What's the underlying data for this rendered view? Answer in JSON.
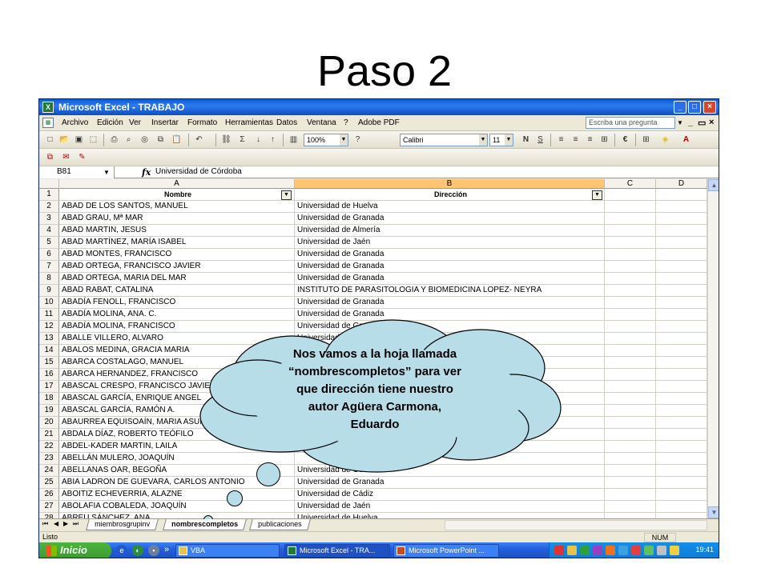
{
  "slide": {
    "title": "Paso 2"
  },
  "window": {
    "title": "Microsoft Excel - TRABAJO",
    "app_icon": "excel-icon",
    "min": "_",
    "max": "□",
    "close": "×"
  },
  "menu": {
    "items": [
      "Archivo",
      "Edición",
      "Ver",
      "Insertar",
      "Formato",
      "Herramientas",
      "Datos",
      "Ventana",
      "?",
      "Adobe PDF"
    ],
    "help_placeholder": "Escriba una pregunta",
    "doc_min": "_",
    "doc_restore": "▭",
    "doc_close": "×"
  },
  "toolbar": {
    "zoom": "100%",
    "font": "Calibri",
    "font_size": "11",
    "bold": "N",
    "underline": "S",
    "currency": "€"
  },
  "formula_bar": {
    "cell_ref": "B81",
    "fx": "fx",
    "content": "Universidad de Córdoba"
  },
  "sheet": {
    "columns": [
      "A",
      "B",
      "C",
      "D"
    ],
    "header_row": {
      "num": "1",
      "a": "Nombre",
      "b": "Dirección"
    },
    "rows": [
      {
        "num": "2",
        "a": "ABAD DE LOS SANTOS, MANUEL",
        "b": "Universidad de Huelva"
      },
      {
        "num": "3",
        "a": "ABAD GRAU, Mª MAR",
        "b": "Universidad de Granada"
      },
      {
        "num": "4",
        "a": "ABAD MARTIN, JESUS",
        "b": "Universidad de Almería"
      },
      {
        "num": "5",
        "a": "ABAD MARTÍNEZ, MARÍA ISABEL",
        "b": "Universidad de Jaén"
      },
      {
        "num": "6",
        "a": "ABAD MONTES, FRANCISCO",
        "b": "Universidad de Granada"
      },
      {
        "num": "7",
        "a": "ABAD ORTEGA, FRANCISCO JAVIER",
        "b": "Universidad de Granada"
      },
      {
        "num": "8",
        "a": "ABAD ORTEGA, MARIA DEL MAR",
        "b": "Universidad de Granada"
      },
      {
        "num": "9",
        "a": "ABAD RABAT, CATALINA",
        "b": "INSTITUTO DE PARASITOLOGIA Y BIOMEDICINA LOPEZ- NEYRA"
      },
      {
        "num": "10",
        "a": "ABADÍA FENOLL, FRANCISCO",
        "b": "Universidad de Granada"
      },
      {
        "num": "11",
        "a": "ABADÍA MOLINA, ANA. C.",
        "b": "Universidad de Granada"
      },
      {
        "num": "12",
        "a": "ABADÍA MOLINA, FRANCISCO",
        "b": "Universidad de Granada"
      },
      {
        "num": "13",
        "a": "ABALLE VILLERO, ALVARO",
        "b": "Universidad de Granada"
      },
      {
        "num": "14",
        "a": "ABALOS MEDINA, GRACIA MARIA",
        "b": ""
      },
      {
        "num": "15",
        "a": "ABARCA COSTALAGO, MANUEL",
        "b": ""
      },
      {
        "num": "16",
        "a": "ABARCA HERNANDEZ, FRANCISCO",
        "b": ""
      },
      {
        "num": "17",
        "a": "ABASCAL CRESPO, FRANCISCO JAVIER",
        "b": ""
      },
      {
        "num": "18",
        "a": "ABASCAL GARCÍA, ENRIQUE ANGEL",
        "b": ""
      },
      {
        "num": "19",
        "a": "ABASCAL GARCÍA, RAMÓN A.",
        "b": ""
      },
      {
        "num": "20",
        "a": "ABAURREA EQUISOAÍN, MARIA ASUNCION",
        "b": ""
      },
      {
        "num": "21",
        "a": "ABDALA DÍAZ, ROBERTO TEÓFILO",
        "b": ""
      },
      {
        "num": "22",
        "a": "ABDEL-KADER MARTIN, LAILA",
        "b": ""
      },
      {
        "num": "23",
        "a": "ABELLÁN MULERO, JOAQUÍN",
        "b": ""
      },
      {
        "num": "24",
        "a": "ABELLANAS OAR, BEGOÑA",
        "b": "Universidad de Córdoba"
      },
      {
        "num": "25",
        "a": "ABIA LADRON DE GUEVARA, CARLOS ANTONIO",
        "b": "Universidad de Granada"
      },
      {
        "num": "26",
        "a": "ABOITIZ ECHEVERRIA, ALAZNE",
        "b": "Universidad de Cádiz"
      },
      {
        "num": "27",
        "a": "ABOLAFIA COBALEDA, JOAQUÍN",
        "b": "Universidad de Jaén"
      },
      {
        "num": "28",
        "a": "ABREU SÁNCHEZ, ANA",
        "b": "Universidad de Huelva"
      }
    ]
  },
  "tabs": {
    "items": [
      {
        "label": "miembrosgrupinv",
        "active": false
      },
      {
        "label": "nombrescompletos",
        "active": true
      },
      {
        "label": "publicaciones",
        "active": false
      }
    ],
    "nav": [
      "⏮",
      "◀",
      "▶",
      "⏭"
    ]
  },
  "status": {
    "left": "Listo",
    "num": "NUM"
  },
  "taskbar": {
    "start": "Inicio",
    "chevron": "»",
    "buttons": [
      {
        "label": "VBA",
        "active": false
      },
      {
        "label": "Microsoft Excel - TRA...",
        "active": true
      },
      {
        "label": "Microsoft PowerPoint ...",
        "active": false
      }
    ],
    "clock": "19:41"
  },
  "callout": {
    "text_lines": [
      "Nos vamos a la hoja llamada",
      "“nombrescompletos” para ver",
      "que dirección tiene nuestro",
      "autor Agüera Carmona,",
      "Eduardo"
    ],
    "fill": "#B7DDE8"
  },
  "colors": {
    "titlebar": "#0A5BD8",
    "selected_header": "#FFC573",
    "excel_green": "#1E7B34"
  }
}
